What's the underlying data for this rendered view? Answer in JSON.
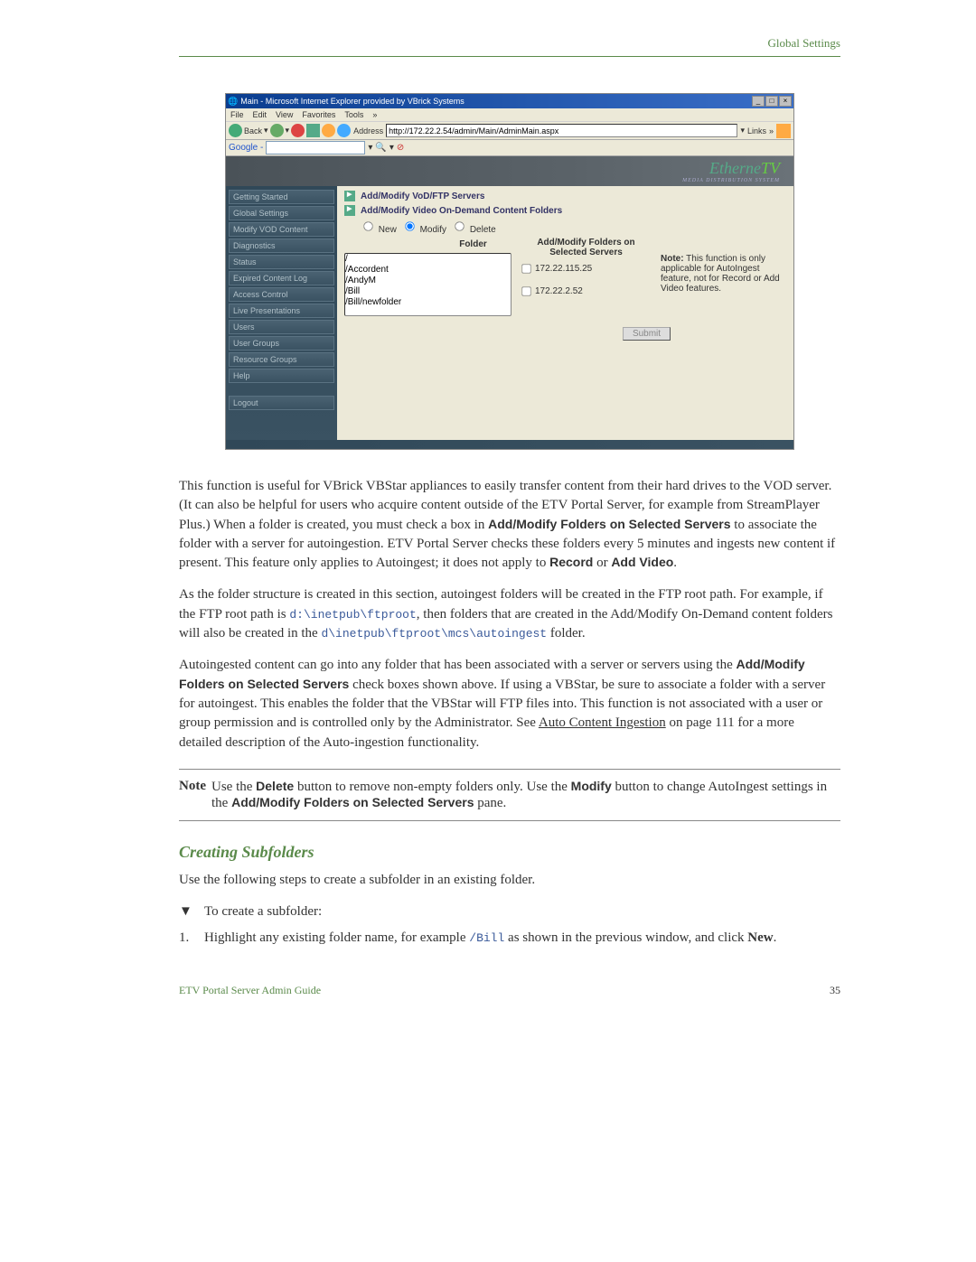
{
  "header": {
    "title": "Global Settings"
  },
  "screenshot": {
    "titlebar": "Main - Microsoft Internet Explorer provided by VBrick Systems",
    "menu": {
      "file": "File",
      "edit": "Edit",
      "view": "View",
      "favorites": "Favorites",
      "tools": "Tools"
    },
    "toolbar": {
      "back": "Back",
      "address_label": "Address",
      "address": "http://172.22.2.54/admin/Main/AdminMain.aspx",
      "links": "Links"
    },
    "google": {
      "label": "Google -"
    },
    "banner": {
      "name": "Etherne",
      "suffix": "TV",
      "sub": "MEDIA DISTRIBUTION SYSTEM"
    },
    "sidebar": {
      "items": [
        "Getting Started",
        "Global Settings",
        "Modify VOD Content",
        "Diagnostics",
        "Status",
        "Expired Content Log",
        "Access Control",
        "Live Presentations",
        "Users",
        "User Groups",
        "Resource Groups",
        "Help"
      ],
      "logout": "Logout"
    },
    "panel": {
      "expander1": "Add/Modify VoD/FTP Servers",
      "expander2": "Add/Modify Video On-Demand Content Folders",
      "radios": {
        "new": "New",
        "modify": "Modify",
        "delete": "Delete"
      },
      "folder_label": "Folder",
      "folders": [
        "/",
        "/Accordent",
        "/AndyM",
        "/Bill",
        "/Bill/newfolder"
      ],
      "servers_title_1": "Add/Modify Folders on",
      "servers_title_2": "Selected Servers",
      "servers": [
        "172.22.115.25",
        "172.22.2.52"
      ],
      "note_label": "Note:",
      "note_text": " This function is only applicable for AutoIngest feature, not for Record or Add Video features.",
      "submit": "Submit"
    }
  },
  "paragraphs": {
    "p1a": "This function is useful for VBrick VBStar appliances to easily transfer content from their hard drives to the VOD server. (It can also be helpful for users who acquire content outside of the ETV Portal Server, for example from StreamPlayer Plus.) When a folder is created, you must check a box in ",
    "p1b": "Add/Modify Folders on Selected Servers",
    "p1c": " to associate the folder with a server for autoingestion. ETV Portal Server checks these folders every 5 minutes and ingests new content if present. This feature only applies to Autoingest; it does not apply to ",
    "p1d": "Record",
    "p1e": " or ",
    "p1f": "Add Video",
    "p1g": ".",
    "p2a": "As the folder structure is created in this section, autoingest folders will be created in the FTP root path. For example, if the FTP root path is ",
    "p2b": "d:\\inetpub\\ftproot",
    "p2c": ", then folders that are created in the Add/Modify On-Demand content folders will also be created in the ",
    "p2d": "d\\inetpub\\ftproot\\mcs\\autoingest",
    "p2e": " folder.",
    "p3a": "Autoingested content can go into any folder that has been associated with a server or servers using the ",
    "p3b": "Add/Modify Folders on Selected Servers",
    "p3c": " check boxes shown above. If using a VBStar, be sure to associate a folder with a server for autoingest. This enables the folder that the VBStar will FTP files into. This function is not associated with a user or group permission and is controlled only by the Administrator. See ",
    "p3d": "Auto Content Ingestion",
    "p3e": " on page 111 for a more detailed description of the Auto-ingestion functionality."
  },
  "note": {
    "label": "Note",
    "a": "Use the ",
    "b": "Delete",
    "c": " button to remove non-empty folders only. Use the ",
    "d": "Modify",
    "e": " button to change AutoIngest settings in the ",
    "f": "Add/Modify Folders on Selected Servers",
    "g": " pane."
  },
  "subhead": "Creating Subfolders",
  "subfolder_intro": "Use the following steps to create a subfolder in an existing folder.",
  "sub_step_marker": "▼",
  "sub_step_label": "To create a subfolder:",
  "step1_num": "1.",
  "step1a": "Highlight any existing folder name, for example ",
  "step1b": "/Bill",
  "step1c": " as shown in the previous window, and click ",
  "step1d": "New",
  "step1e": ".",
  "footer": {
    "left": "ETV Portal Server Admin Guide",
    "right": "35"
  }
}
